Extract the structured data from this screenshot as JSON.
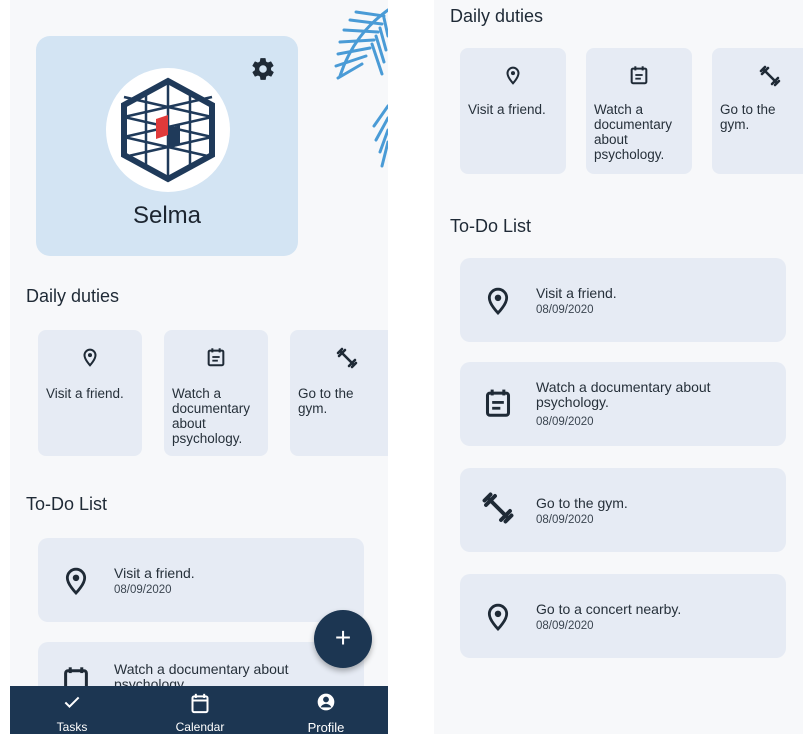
{
  "left_screen": {
    "profile": {
      "name": "Selma"
    },
    "daily_duties": {
      "title": "Daily duties",
      "items": [
        {
          "label": "Visit a friend.",
          "icon": "location-pin-icon"
        },
        {
          "label": "Watch a documentary about psychology.",
          "icon": "calendar-note-icon"
        },
        {
          "label": "Go to the gym.",
          "icon": "dumbbell-icon"
        }
      ]
    },
    "todo": {
      "title": "To-Do List",
      "items": [
        {
          "title": "Visit a friend.",
          "date": "08/09/2020",
          "icon": "location-pin-icon"
        },
        {
          "title": "Watch a documentary about psychology.",
          "icon": "calendar-note-icon"
        }
      ]
    },
    "fab": {
      "label": "+"
    },
    "nav": {
      "items": [
        {
          "label": "Tasks",
          "icon": "check-icon"
        },
        {
          "label": "Calendar",
          "icon": "calendar-icon"
        },
        {
          "label": "Profile",
          "icon": "profile-icon"
        }
      ]
    }
  },
  "right_screen": {
    "daily_duties": {
      "title": "Daily duties",
      "items": [
        {
          "label": "Visit a friend.",
          "icon": "location-pin-icon"
        },
        {
          "label": "Watch a documentary about psychology.",
          "icon": "calendar-note-icon"
        },
        {
          "label": "Go to the gym.",
          "icon": "dumbbell-icon"
        }
      ]
    },
    "todo": {
      "title": "To-Do List",
      "items": [
        {
          "title": "Visit a friend.",
          "date": "08/09/2020",
          "icon": "location-pin-icon"
        },
        {
          "title": "Watch a documentary about psychology.",
          "date": "08/09/2020",
          "icon": "calendar-note-icon"
        },
        {
          "title": "Go to the gym.",
          "date": "08/09/2020",
          "icon": "dumbbell-icon"
        },
        {
          "title": "Go to a concert nearby.",
          "date": "08/09/2020",
          "icon": "location-pin-icon"
        }
      ]
    }
  },
  "colors": {
    "profile_card": "#d3e4f3",
    "card": "#e6ebf4",
    "nav_bg": "#1c3652",
    "accent_red": "#e03a3a",
    "hex_navy": "#1f3a5a"
  }
}
